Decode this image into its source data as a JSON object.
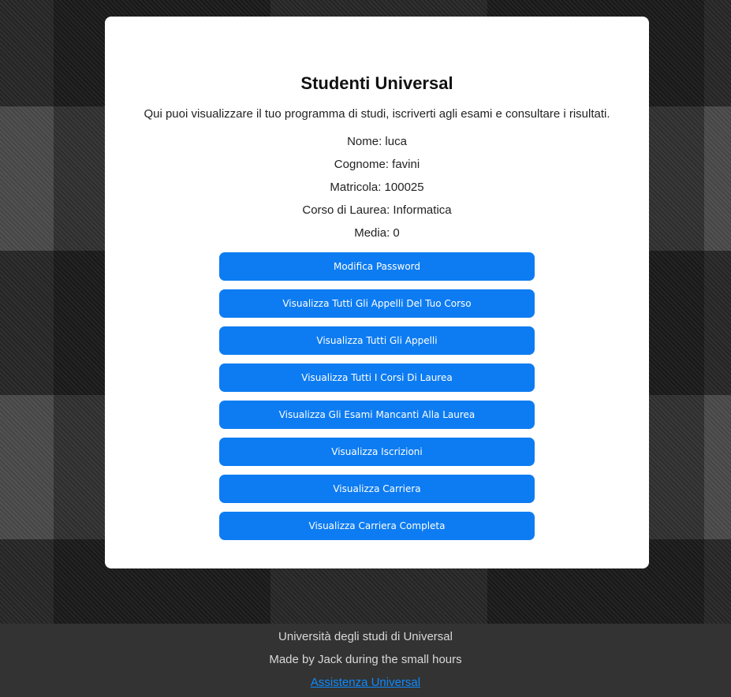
{
  "card": {
    "title": "Studenti Universal",
    "intro": "Qui puoi visualizzare il tuo programma di studi, iscriverti agli esami e consultare i risultati.",
    "info": [
      "Nome: luca",
      "Cognome: favini",
      "Matricola: 100025",
      "Corso di Laurea: Informatica",
      "Media: 0"
    ]
  },
  "buttons": [
    "Modifica Password",
    "Visualizza Tutti Gli Appelli Del Tuo Corso",
    "Visualizza Tutti Gli Appelli",
    "Visualizza Tutti I Corsi Di Laurea",
    "Visualizza Gli Esami Mancanti Alla Laurea",
    "Visualizza Iscrizioni",
    "Visualizza Carriera",
    "Visualizza Carriera Completa"
  ],
  "footer": {
    "university": "Università degli studi di Universal",
    "credits": "Made by Jack during the small hours",
    "support_link": "Assistenza Universal"
  },
  "colors": {
    "button": "#0d7cf2",
    "footer_bg": "#333333",
    "link": "#0d8bff"
  }
}
